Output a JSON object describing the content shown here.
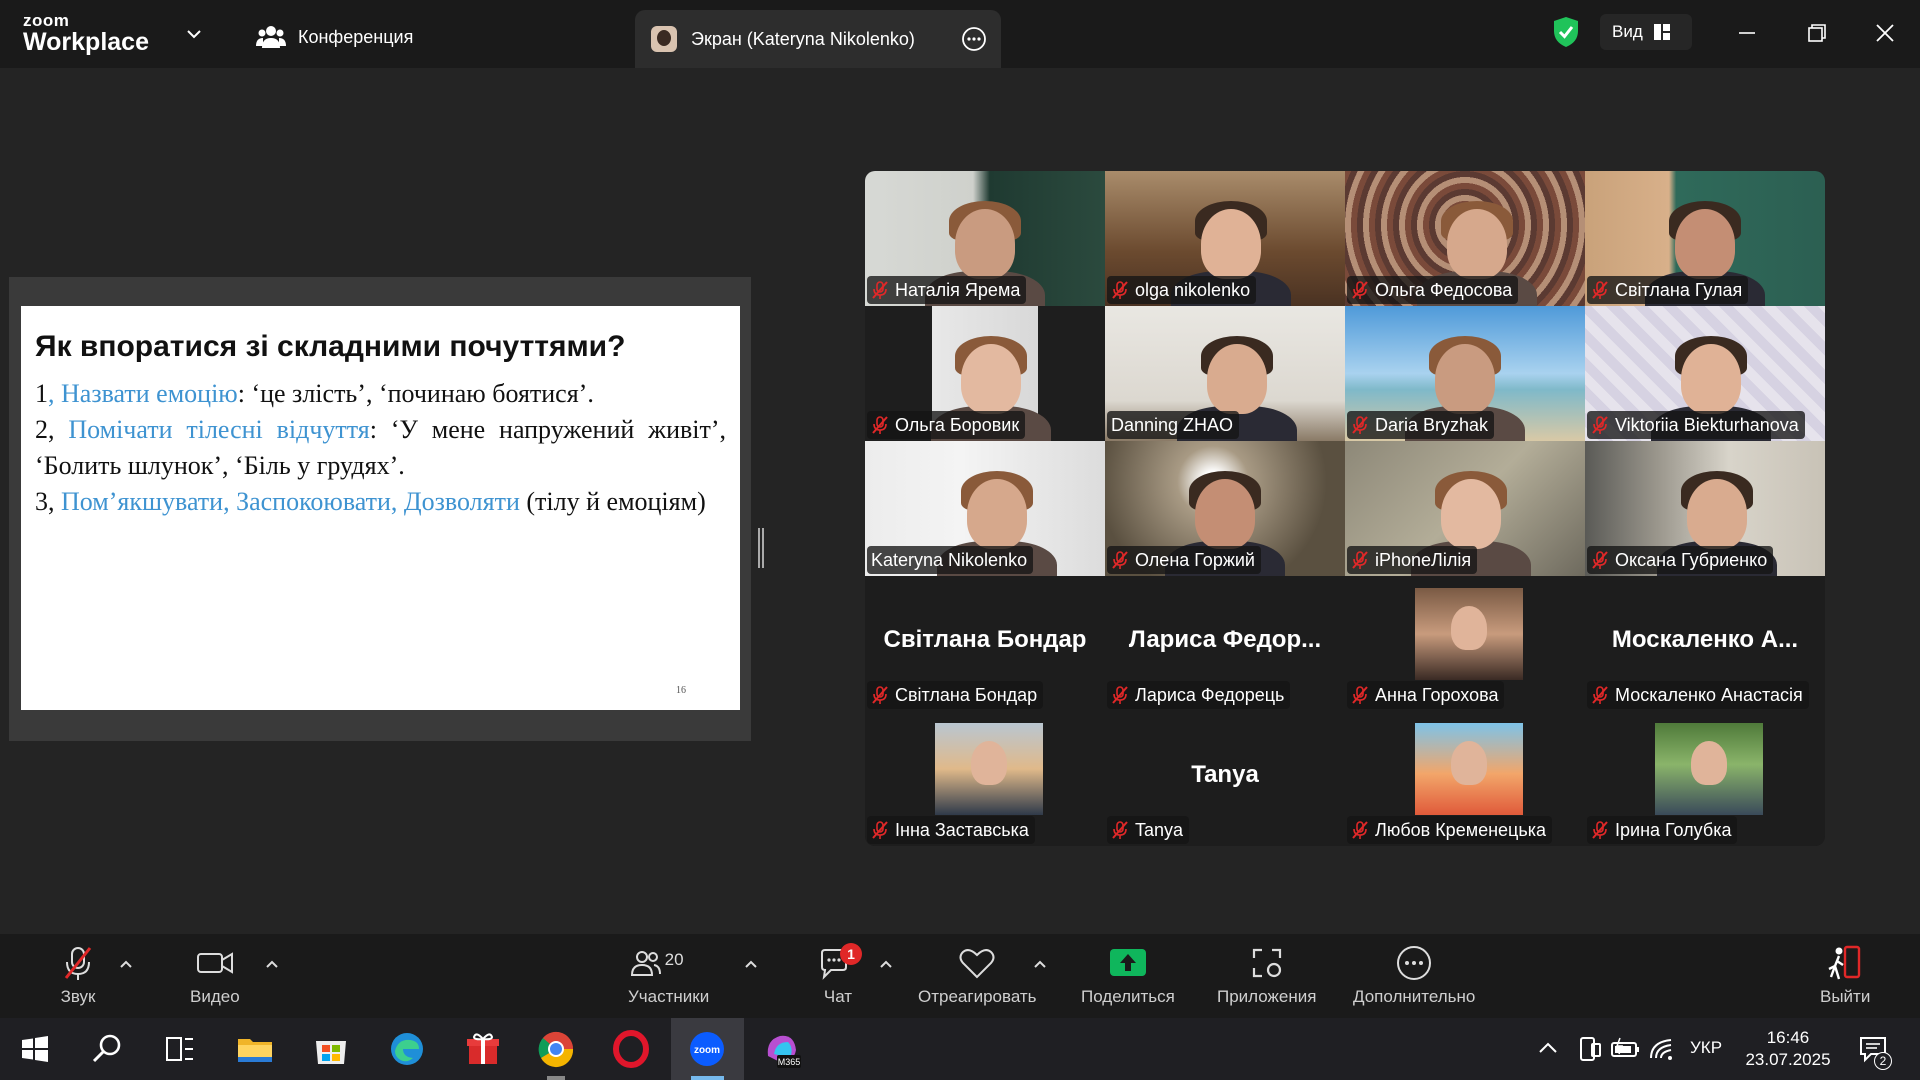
{
  "app": {
    "logo_line1": "zoom",
    "logo_line2": "Workplace",
    "meeting_tab": "Конференция",
    "screen_tab": "Экран (Kateryna Nikolenko)",
    "view_label": "Вид"
  },
  "slide": {
    "title": "Як впоратися зі складними почуттями?",
    "lines": [
      {
        "num": "1",
        "hl": ", Назвати емоцію",
        "rest": ": ‘це злість’, ‘починаю боятися’."
      },
      {
        "num": "2, ",
        "hl": "Помічати тілесні відчуття",
        "rest": ": ‘У мене напружений живіт’, ‘Болить шлунок’, ‘Біль у грудях’."
      },
      {
        "num": "3, ",
        "hl": "Пом’якшувати, Заспокоювати, Дозволяти",
        "rest": " (тілу й емоціям)"
      }
    ],
    "page_number": "16"
  },
  "participants": [
    {
      "name": "Наталія Ярема",
      "muted": true,
      "video": "classroom"
    },
    {
      "name": "olga nikolenko",
      "muted": true,
      "video": "library"
    },
    {
      "name": "Ольга Федосова",
      "muted": true,
      "video": "carpet"
    },
    {
      "name": "Світлана Гулая",
      "muted": true,
      "video": "room-green"
    },
    {
      "name": "Ольга Боровик",
      "muted": true,
      "video": "wall"
    },
    {
      "name": "Danning ZHAO",
      "muted": false,
      "video": "office"
    },
    {
      "name": "Daria Bryzhak",
      "muted": true,
      "video": "beach"
    },
    {
      "name": "Viktoriia Biekturhanova",
      "muted": true,
      "video": "floral"
    },
    {
      "name": "Kateryna Nikolenko",
      "muted": false,
      "video": "bookshelf",
      "active": true
    },
    {
      "name": "Олена Горжий",
      "muted": true,
      "video": "ceiling"
    },
    {
      "name": "iPhoneЛілія",
      "muted": true,
      "video": "blur"
    },
    {
      "name": "Оксана Губриенко",
      "muted": true,
      "video": "room-art"
    },
    {
      "name": "Світлана Бондар",
      "muted": true,
      "big": "Світлана Бондар"
    },
    {
      "name": "Лариса Федорець",
      "muted": true,
      "big": "Лариса Федор..."
    },
    {
      "name": "Анна Горохова",
      "muted": true,
      "photo": "woman-dark"
    },
    {
      "name": "Москаленко Анастасія",
      "muted": true,
      "big": "Москаленко А..."
    },
    {
      "name": "Інна Заставська",
      "muted": true,
      "photo": "woman-blonde"
    },
    {
      "name": "Tanya",
      "muted": true,
      "big": "Tanya"
    },
    {
      "name": "Любов Кременецька",
      "muted": true,
      "photo": "illustration"
    },
    {
      "name": "Ірина Голубка",
      "muted": true,
      "photo": "woman-garden"
    }
  ],
  "toolbar": {
    "audio": "Звук",
    "video": "Видео",
    "participants": "Участники",
    "participants_count": "20",
    "chat": "Чат",
    "chat_badge": "1",
    "react": "Отреагировать",
    "share": "Поделиться",
    "apps": "Приложения",
    "more": "Дополнительно",
    "leave": "Выйти"
  },
  "taskbar": {
    "lang": "УКР",
    "time": "16:46",
    "date": "23.07.2025",
    "notifications": "2",
    "m365_label": "M365"
  },
  "colors": {
    "active_speaker": "#23d18b",
    "share_green": "#0fb65c",
    "slide_highlight": "#3e93d1",
    "muted_red": "#e02828"
  }
}
